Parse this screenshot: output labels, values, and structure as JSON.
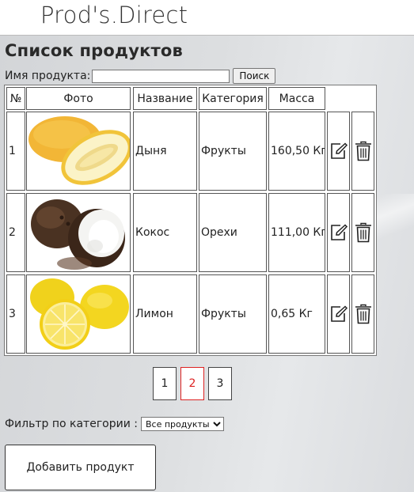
{
  "header": {
    "brand": "Prod's.Direct"
  },
  "page": {
    "title": "Список продуктов"
  },
  "search": {
    "label": "Имя продукта:",
    "value": "",
    "placeholder": "",
    "button_label": "Поиск"
  },
  "table": {
    "columns": [
      "№",
      "Фото",
      "Название",
      "Категория",
      "Масса"
    ],
    "rows": [
      {
        "num": "1",
        "photo": "melon-photo",
        "name": "Дыня",
        "category": "Фрукты",
        "mass": "160,50 Кг"
      },
      {
        "num": "2",
        "photo": "coconut-photo",
        "name": "Кокос",
        "category": "Орехи",
        "mass": "111,00 Кг"
      },
      {
        "num": "3",
        "photo": "lemon-photo",
        "name": "Лимон",
        "category": "Фрукты",
        "mass": "0,65 Кг"
      }
    ],
    "row_icons": [
      "edit-icon",
      "trash-icon"
    ]
  },
  "pagination": {
    "pages": [
      "1",
      "2",
      "3"
    ],
    "active_page": "2",
    "active_color": "#dd2222"
  },
  "filter": {
    "label": "Фильтр по категории :",
    "selected": "Все продукты"
  },
  "add_button": {
    "label": "Добавить продукт"
  }
}
